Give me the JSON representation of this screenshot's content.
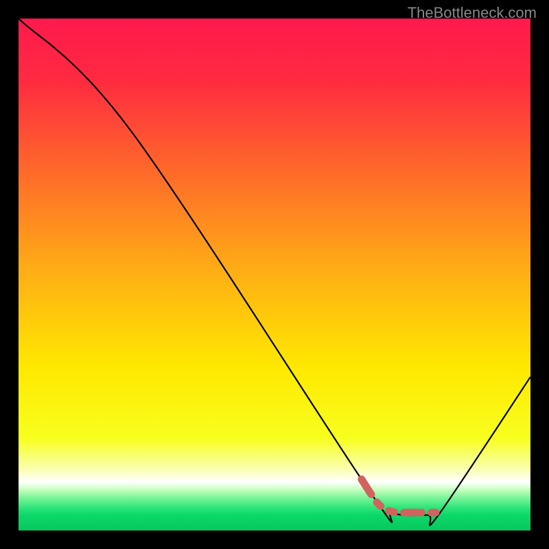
{
  "watermark": "TheBottleneck.com",
  "chart_data": {
    "type": "line",
    "title": "",
    "xlabel": "",
    "ylabel": "",
    "xlim": [
      0,
      100
    ],
    "ylim": [
      0,
      100
    ],
    "series": [
      {
        "name": "bottleneck-curve",
        "x": [
          0,
          22,
          68,
          73,
          80,
          82,
          100
        ],
        "y": [
          100,
          78,
          8.5,
          3.5,
          3,
          3,
          30
        ],
        "style": "solid-black"
      },
      {
        "name": "optimal-marker",
        "x": [
          67,
          70,
          72,
          74,
          76,
          78,
          80,
          81.5
        ],
        "y": [
          10,
          5.5,
          4,
          3.5,
          3.5,
          3.5,
          3.5,
          3.5
        ],
        "style": "dashed-red-thick"
      }
    ],
    "background_gradient": {
      "stops": [
        {
          "offset": 0.0,
          "color": "#ff1a4d"
        },
        {
          "offset": 0.12,
          "color": "#ff2a40"
        },
        {
          "offset": 0.3,
          "color": "#ff6a2a"
        },
        {
          "offset": 0.5,
          "color": "#ffb014"
        },
        {
          "offset": 0.68,
          "color": "#ffe800"
        },
        {
          "offset": 0.82,
          "color": "#f7ff1e"
        },
        {
          "offset": 0.88,
          "color": "#faffb0"
        },
        {
          "offset": 0.905,
          "color": "#ffffff"
        },
        {
          "offset": 0.92,
          "color": "#c8ffc0"
        },
        {
          "offset": 0.935,
          "color": "#80f59a"
        },
        {
          "offset": 0.955,
          "color": "#2ee67a"
        },
        {
          "offset": 0.97,
          "color": "#0bd868"
        },
        {
          "offset": 1.0,
          "color": "#07c85e"
        }
      ]
    }
  }
}
